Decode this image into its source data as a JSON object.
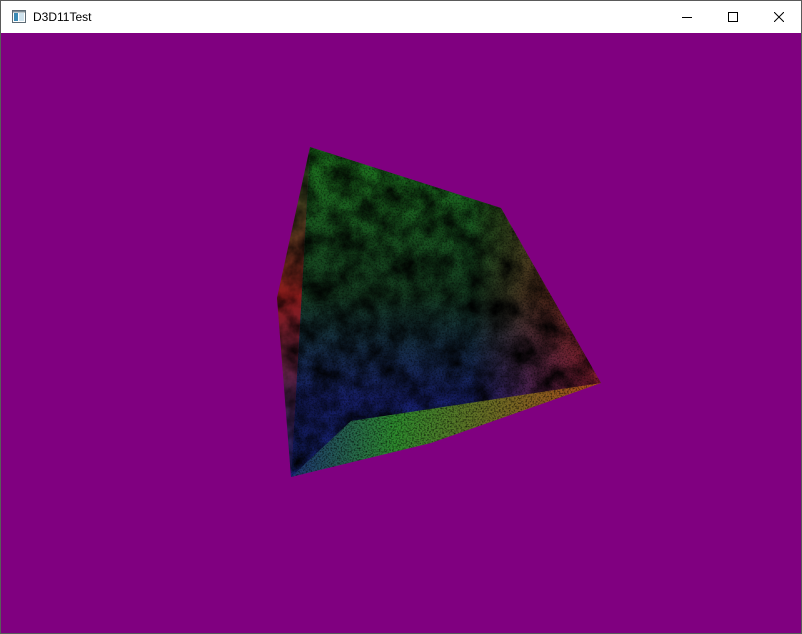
{
  "window": {
    "title": "D3D11Test",
    "app_icon": "window-app-icon",
    "controls": [
      {
        "name": "minimize-button",
        "icon": "minimize-icon"
      },
      {
        "name": "maximize-button",
        "icon": "maximize-icon"
      },
      {
        "name": "close-button",
        "icon": "close-icon"
      }
    ]
  },
  "viewport": {
    "clear_color": "#800080",
    "object": "textured-cube",
    "face_tints": [
      "#1f7a1f",
      "#1a2a8c",
      "#b31a1a"
    ]
  }
}
